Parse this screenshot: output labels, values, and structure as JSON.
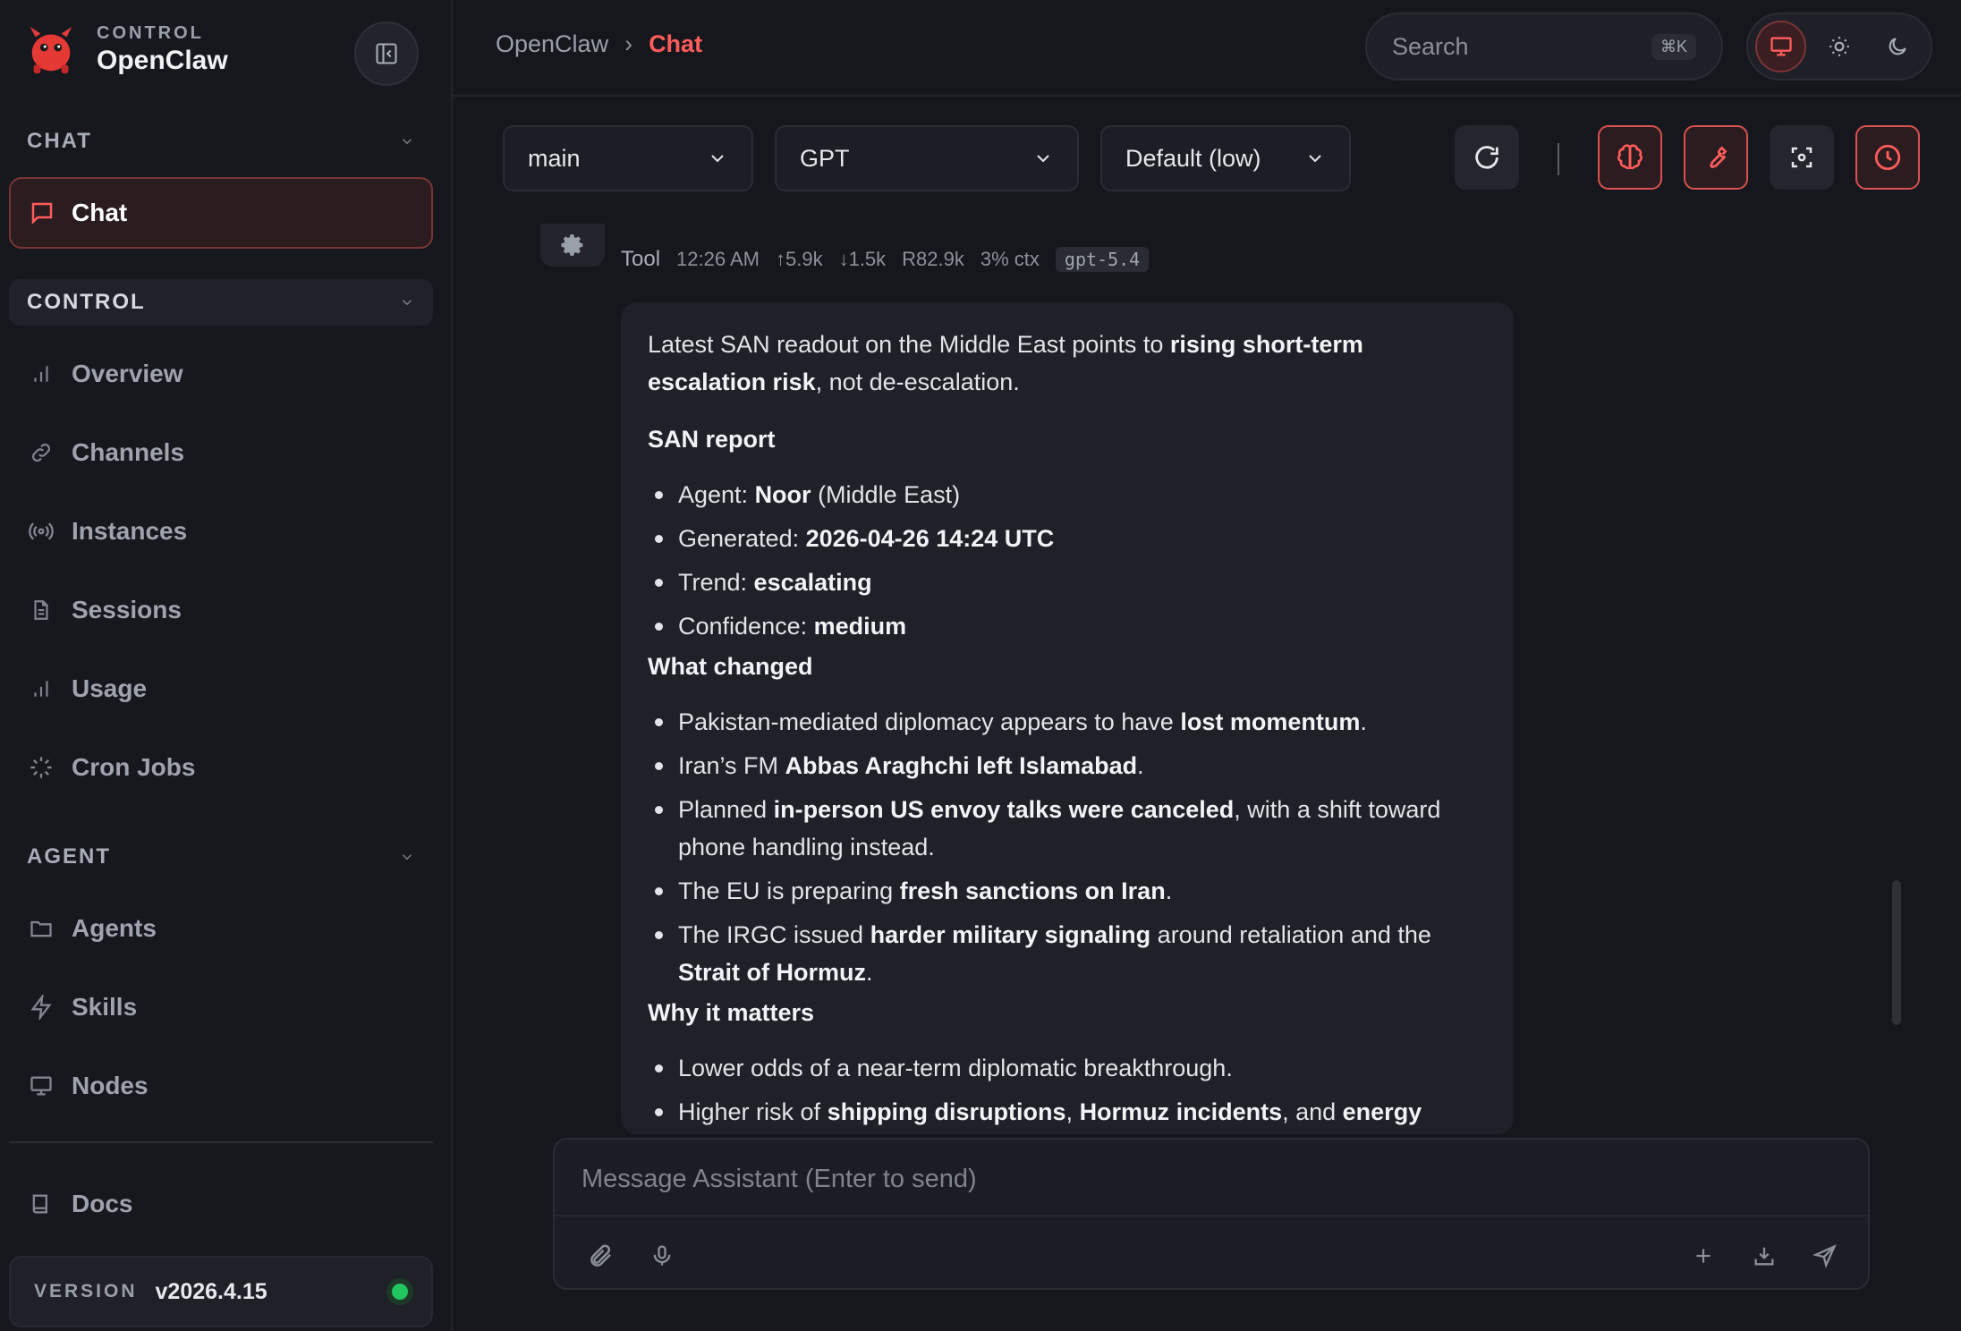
{
  "brand": {
    "sub": "CONTROL",
    "name": "OpenClaw"
  },
  "sidebar": {
    "sections": {
      "chat": "CHAT",
      "control": "CONTROL",
      "agent": "AGENT"
    },
    "chat_item": "Chat",
    "control_items": [
      "Overview",
      "Channels",
      "Instances",
      "Sessions",
      "Usage",
      "Cron Jobs"
    ],
    "agent_items": [
      "Agents",
      "Skills",
      "Nodes"
    ],
    "docs": "Docs",
    "version_label": "VERSION",
    "version_value": "v2026.4.15"
  },
  "header": {
    "breadcrumb_root": "OpenClaw",
    "breadcrumb_sep": "›",
    "breadcrumb_current": "Chat",
    "search_placeholder": "Search",
    "search_shortcut": "⌘K"
  },
  "toolbar": {
    "session": "main",
    "model": "GPT",
    "thinking": "Default (low)"
  },
  "message": {
    "sender": "Tool",
    "time": "12:26 AM",
    "tokens_in": "↑5.9k",
    "tokens_out": "↓1.5k",
    "reads": "R82.9k",
    "ctx": "3% ctx",
    "model": "gpt-5.4",
    "intro_a": "Latest SAN readout on the Middle East points to ",
    "intro_b": "rising short-term escalation risk",
    "intro_c": ", not de-escalation.",
    "report_heading": "SAN report",
    "report": [
      {
        "k": "Agent: ",
        "v": "Noor",
        "s": " (Middle East)"
      },
      {
        "k": "Generated: ",
        "v": "2026-04-26 14:24 UTC",
        "s": ""
      },
      {
        "k": "Trend: ",
        "v": "escalating",
        "s": ""
      },
      {
        "k": "Confidence: ",
        "v": "medium",
        "s": ""
      }
    ],
    "changed_heading": "What changed",
    "changed": [
      {
        "a": "Pakistan-mediated diplomacy appears to have ",
        "b": "lost momentum",
        "c": "."
      },
      {
        "a": "Iran’s FM ",
        "b": "Abbas Araghchi left Islamabad",
        "c": "."
      },
      {
        "a": "Planned ",
        "b": "in-person US envoy talks were canceled",
        "c": ", with a shift toward phone handling instead."
      },
      {
        "a": "The EU is preparing ",
        "b": "fresh sanctions on Iran",
        "c": "."
      },
      {
        "a": "The IRGC issued ",
        "b": "harder military signaling",
        "c": " around retaliation and the ",
        "d": "Strait of Hormuz",
        "e": "."
      }
    ],
    "matters_heading": "Why it matters",
    "matters_1": "Lower odds of a near-term diplomatic breakthrough.",
    "matters_2": {
      "a": "Higher risk of ",
      "b": "shipping disruptions",
      "c": ", ",
      "d": "Hormuz incidents",
      "e": ", and ",
      "f": "energy market volatility",
      "g": "."
    }
  },
  "composer": {
    "placeholder": "Message Assistant (Enter to send)"
  },
  "colors": {
    "accent": "#ff5c5c",
    "status": "#22c55e"
  }
}
